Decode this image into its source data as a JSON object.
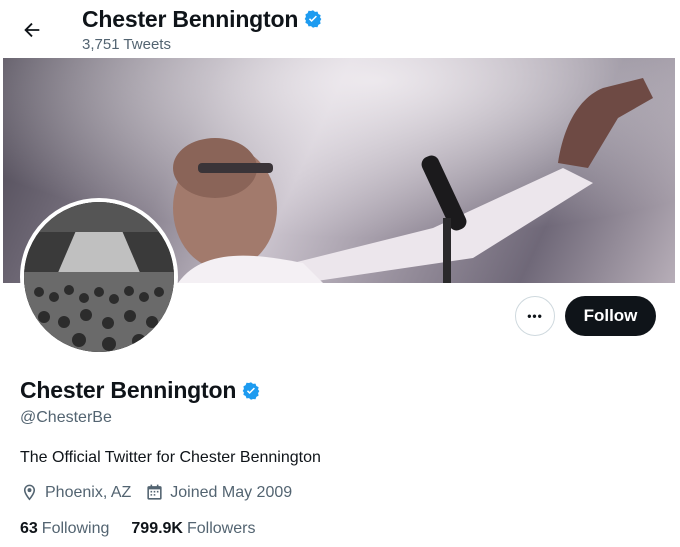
{
  "header": {
    "title": "Chester Bennington",
    "tweet_count": "3,751 Tweets"
  },
  "profile": {
    "name": "Chester Bennington",
    "handle": "@ChesterBe",
    "bio": "The Official Twitter for Chester Bennington",
    "location": "Phoenix, AZ",
    "joined": "Joined May 2009",
    "following_count": "63",
    "following_label": "Following",
    "followers_count": "799.9K",
    "followers_label": "Followers",
    "verified": true
  },
  "actions": {
    "follow_label": "Follow",
    "more_label": "•••"
  },
  "icons": {
    "back": "arrow-left-icon",
    "verified": "verified-badge-icon",
    "location": "location-pin-icon",
    "calendar": "calendar-icon",
    "more": "more-dots-icon"
  },
  "colors": {
    "text_primary": "#0f1419",
    "text_secondary": "#536471",
    "verified_blue": "#1d9bf0",
    "follow_bg": "#0f1419",
    "follow_text": "#ffffff",
    "border": "#cfd9de"
  }
}
